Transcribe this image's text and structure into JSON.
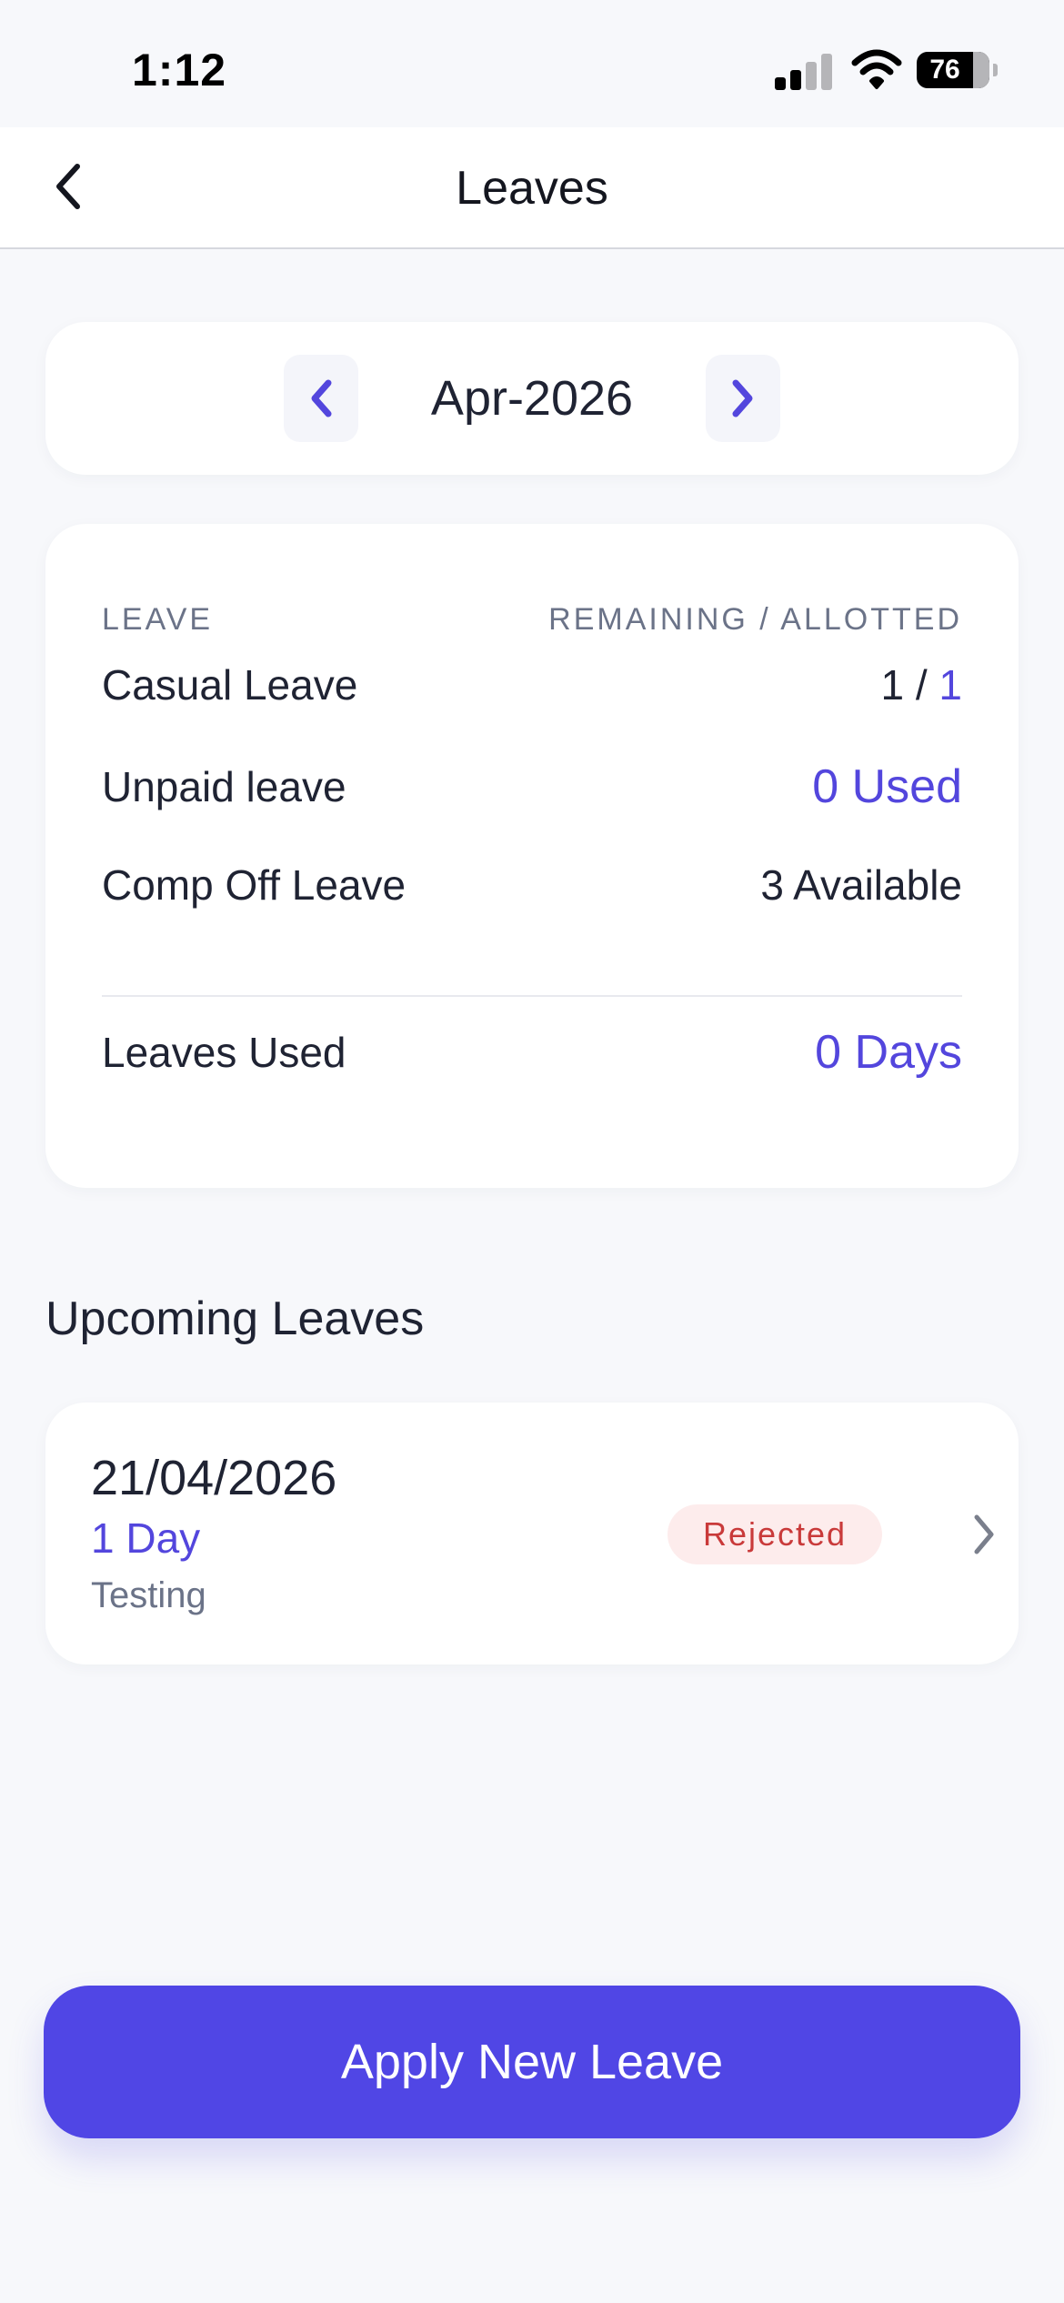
{
  "status_bar": {
    "time": "1:12",
    "battery_level": "76"
  },
  "nav": {
    "title": "Leaves",
    "back_icon": "chevron-left-icon"
  },
  "month_selector": {
    "label": "Apr-2026",
    "prev_icon": "chevron-left-icon",
    "next_icon": "chevron-right-icon"
  },
  "summary": {
    "header_left": "LEAVE",
    "header_right": "REMAINING / ALLOTTED",
    "rows": [
      {
        "name": "Casual Leave",
        "remaining": "1 / ",
        "allotted": "1"
      },
      {
        "name": "Unpaid leave",
        "value": "0 Used"
      },
      {
        "name": "Comp Off Leave",
        "value": "3 Available"
      }
    ],
    "total_label": "Leaves Used",
    "total_value": "0 Days"
  },
  "upcoming": {
    "section_title": "Upcoming Leaves",
    "items": [
      {
        "date": "21/04/2026",
        "duration": "1 Day",
        "reason": "Testing",
        "status": "Rejected"
      }
    ]
  },
  "apply_button": {
    "label": "Apply New Leave"
  },
  "colors": {
    "accent": "#5046e5",
    "rejected_text": "#c93a3a",
    "rejected_bg": "#fdecec",
    "background": "#f7f8fb"
  }
}
